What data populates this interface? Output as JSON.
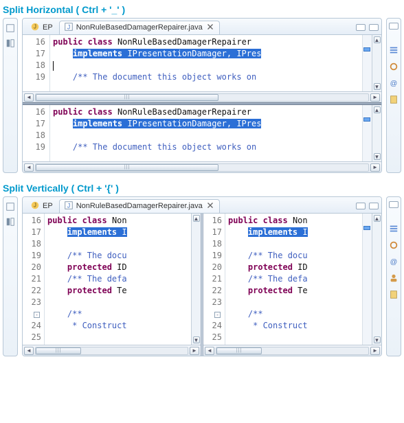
{
  "titles": {
    "horizontal": "Split Horizontal ( Ctrl  + '_' )",
    "vertical": "Split Vertically ( Ctrl + '{' )"
  },
  "tabs": {
    "inactive": "EP",
    "active": "NonRuleBasedDamagerRepairer.java",
    "close": "✕"
  },
  "code": {
    "kw_public": "public",
    "kw_class": "class",
    "kw_implements": "implements",
    "kw_protected": "protected",
    "class_name_full": "NonRuleBasedDamagerRepairer",
    "class_name_trunc": "Non",
    "impl_full": " IPresentationDamager, IPres",
    "impl_trunc": " I",
    "doccomment_full": "/** The document this object works on ",
    "doccomment_trunc": "/** The docu",
    "prot1_trunc": " ID",
    "defcomment_trunc": "/** The defa",
    "prot2_trunc": " Te",
    "jdoc_open": "/**",
    "jdoc_line_trunc": " * Construct"
  },
  "lines": {
    "h": [
      "16",
      "17",
      "18",
      "19"
    ],
    "v": [
      "16",
      "17",
      "18",
      "19",
      "20",
      "21",
      "22",
      "23",
      "24",
      "25"
    ]
  },
  "icons": {
    "java": "J",
    "close": "x",
    "min": "min",
    "max": "max",
    "left": "◄",
    "right": "►",
    "up": "▲",
    "down": "▼"
  }
}
